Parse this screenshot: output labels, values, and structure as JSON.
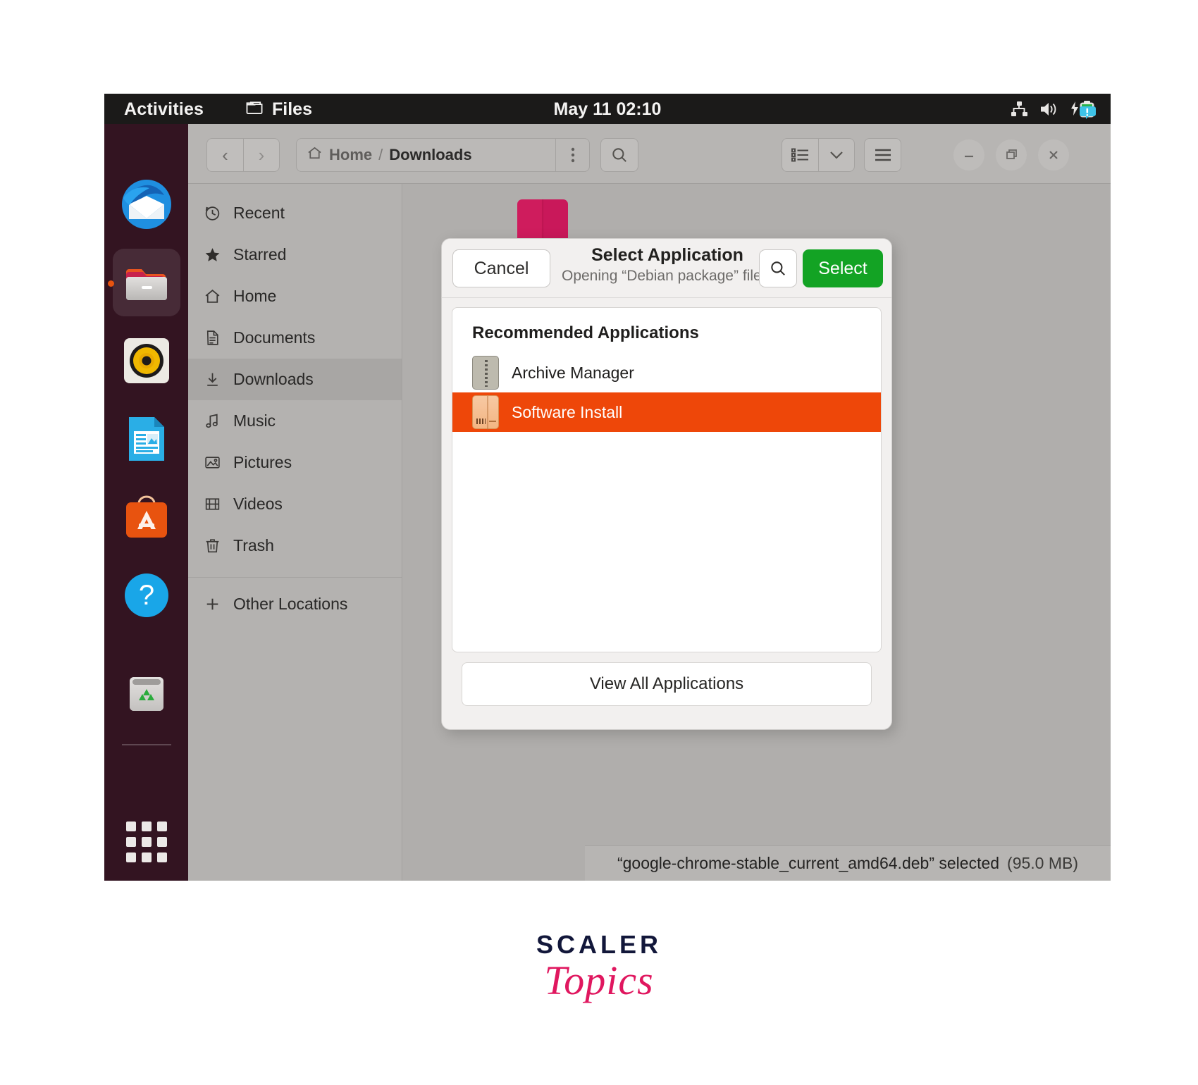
{
  "topbar": {
    "activities": "Activities",
    "app_name": "Files",
    "app_icon": "folder-icon",
    "clock": "May 11  02:10",
    "tray": [
      {
        "name": "network-wired-icon"
      },
      {
        "name": "volume-icon"
      },
      {
        "name": "battery-charging-icon"
      },
      {
        "name": "notification-badge-icon"
      }
    ]
  },
  "dock": {
    "items": [
      {
        "name": "thunderbird",
        "label": "Thunderbird Mail",
        "running": false,
        "active": false
      },
      {
        "name": "files",
        "label": "Files",
        "running": true,
        "active": true
      },
      {
        "name": "rhythmbox",
        "label": "Rhythmbox",
        "running": false,
        "active": false
      },
      {
        "name": "libreoffice-writer",
        "label": "LibreOffice Writer",
        "running": false,
        "active": false
      },
      {
        "name": "ubuntu-software",
        "label": "Ubuntu Software",
        "running": false,
        "active": false
      },
      {
        "name": "help",
        "label": "Help",
        "running": false,
        "active": false
      },
      {
        "name": "trash",
        "label": "Trash",
        "running": false,
        "active": false
      }
    ],
    "show_apps_label": "Show Applications"
  },
  "window": {
    "nav": {
      "back": "‹",
      "forward": "›"
    },
    "path": {
      "home": "Home",
      "separator": "/",
      "current": "Downloads"
    },
    "buttons": {
      "path_menu": "path-menu-button",
      "search": "search-button",
      "view_list": "view-list-button",
      "view_dropdown": "view-dropdown-button",
      "hamburger": "main-menu-button",
      "minimize": "–",
      "maximize": "❐",
      "close": "✕"
    },
    "sidebar": [
      {
        "label": "Recent",
        "icon": "clock-icon",
        "selected": false
      },
      {
        "label": "Starred",
        "icon": "star-icon",
        "selected": false
      },
      {
        "label": "Home",
        "icon": "home-icon",
        "selected": false
      },
      {
        "label": "Documents",
        "icon": "document-icon",
        "selected": false
      },
      {
        "label": "Downloads",
        "icon": "download-icon",
        "selected": true
      },
      {
        "label": "Music",
        "icon": "music-note-icon",
        "selected": false
      },
      {
        "label": "Pictures",
        "icon": "image-icon",
        "selected": false
      },
      {
        "label": "Videos",
        "icon": "film-icon",
        "selected": false
      },
      {
        "label": "Trash",
        "icon": "trash-icon",
        "selected": false
      }
    ],
    "sidebar_other": {
      "label": "Other Locations",
      "icon": "plus-icon"
    },
    "statusbar": {
      "text": "“google-chrome-stable_current_amd64.deb” selected",
      "size": "(95.0 MB)"
    }
  },
  "dialog": {
    "cancel_label": "Cancel",
    "title": "Select Application",
    "subtitle": "Opening “Debian package” files.",
    "search_icon": "search-icon",
    "select_label": "Select",
    "list_title": "Recommended Applications",
    "apps": [
      {
        "label": "Archive Manager",
        "icon": "archive-manager-icon",
        "selected": false
      },
      {
        "label": "Software Install",
        "icon": "deb-package-icon",
        "selected": true
      }
    ],
    "view_all_label": "View All Applications"
  },
  "logo": {
    "line1": "SCALER",
    "line2": "Topics"
  },
  "colors": {
    "accent_orange": "#ee4709",
    "select_green": "#13a324",
    "topbar_black": "#1b1a19",
    "dock_purple": "#30101e",
    "logo_pink": "#e0175f"
  }
}
